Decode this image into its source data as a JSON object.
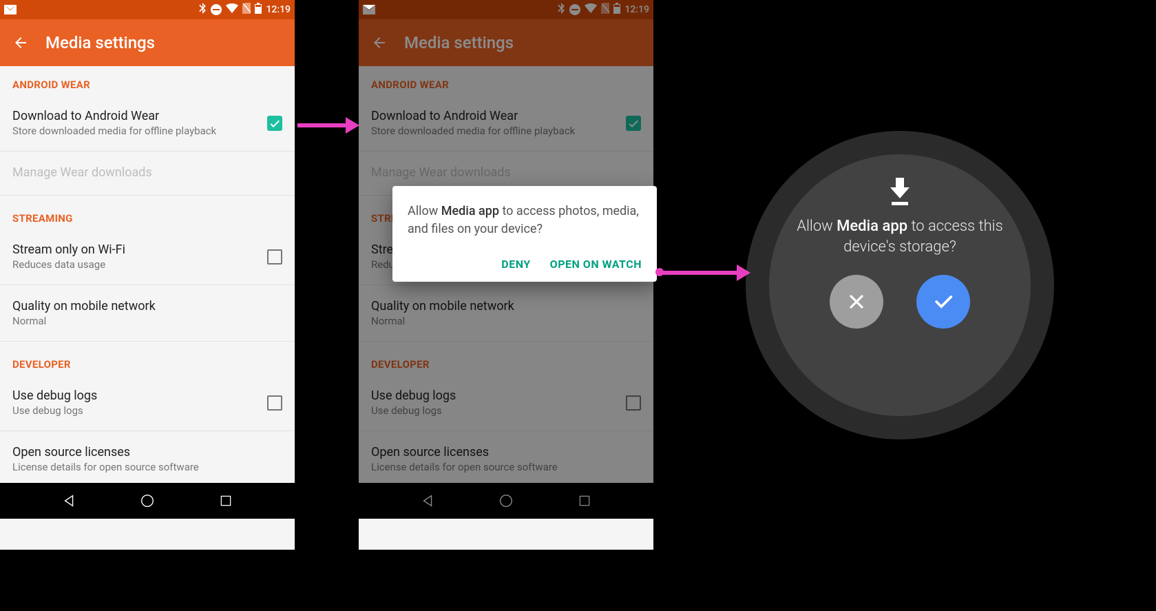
{
  "status": {
    "time": "12:19"
  },
  "appbar": {
    "title": "Media settings"
  },
  "sections": {
    "wear": {
      "header": "ANDROID WEAR",
      "download": {
        "title": "Download to Android Wear",
        "sub": "Store downloaded media for offline playback"
      },
      "manage": {
        "title": "Manage Wear downloads"
      }
    },
    "streaming": {
      "header": "STREAMING",
      "wifi": {
        "title": "Stream only on Wi-Fi",
        "sub": "Reduces data usage"
      },
      "quality": {
        "title": "Quality on mobile network",
        "sub": "Normal"
      }
    },
    "developer": {
      "header": "DEVELOPER",
      "debug": {
        "title": "Use debug logs",
        "sub": "Use debug logs"
      },
      "oss": {
        "title": "Open source licenses",
        "sub": "License details for open source software"
      }
    }
  },
  "dialog": {
    "prefix": "Allow ",
    "bold": "Media app",
    "suffix": " to access photos, media, and files on your device?",
    "deny": "DENY",
    "open": "OPEN ON WATCH"
  },
  "watch": {
    "prefix": "Allow ",
    "bold": "Media app",
    "suffix": " to access this device's storage?"
  }
}
